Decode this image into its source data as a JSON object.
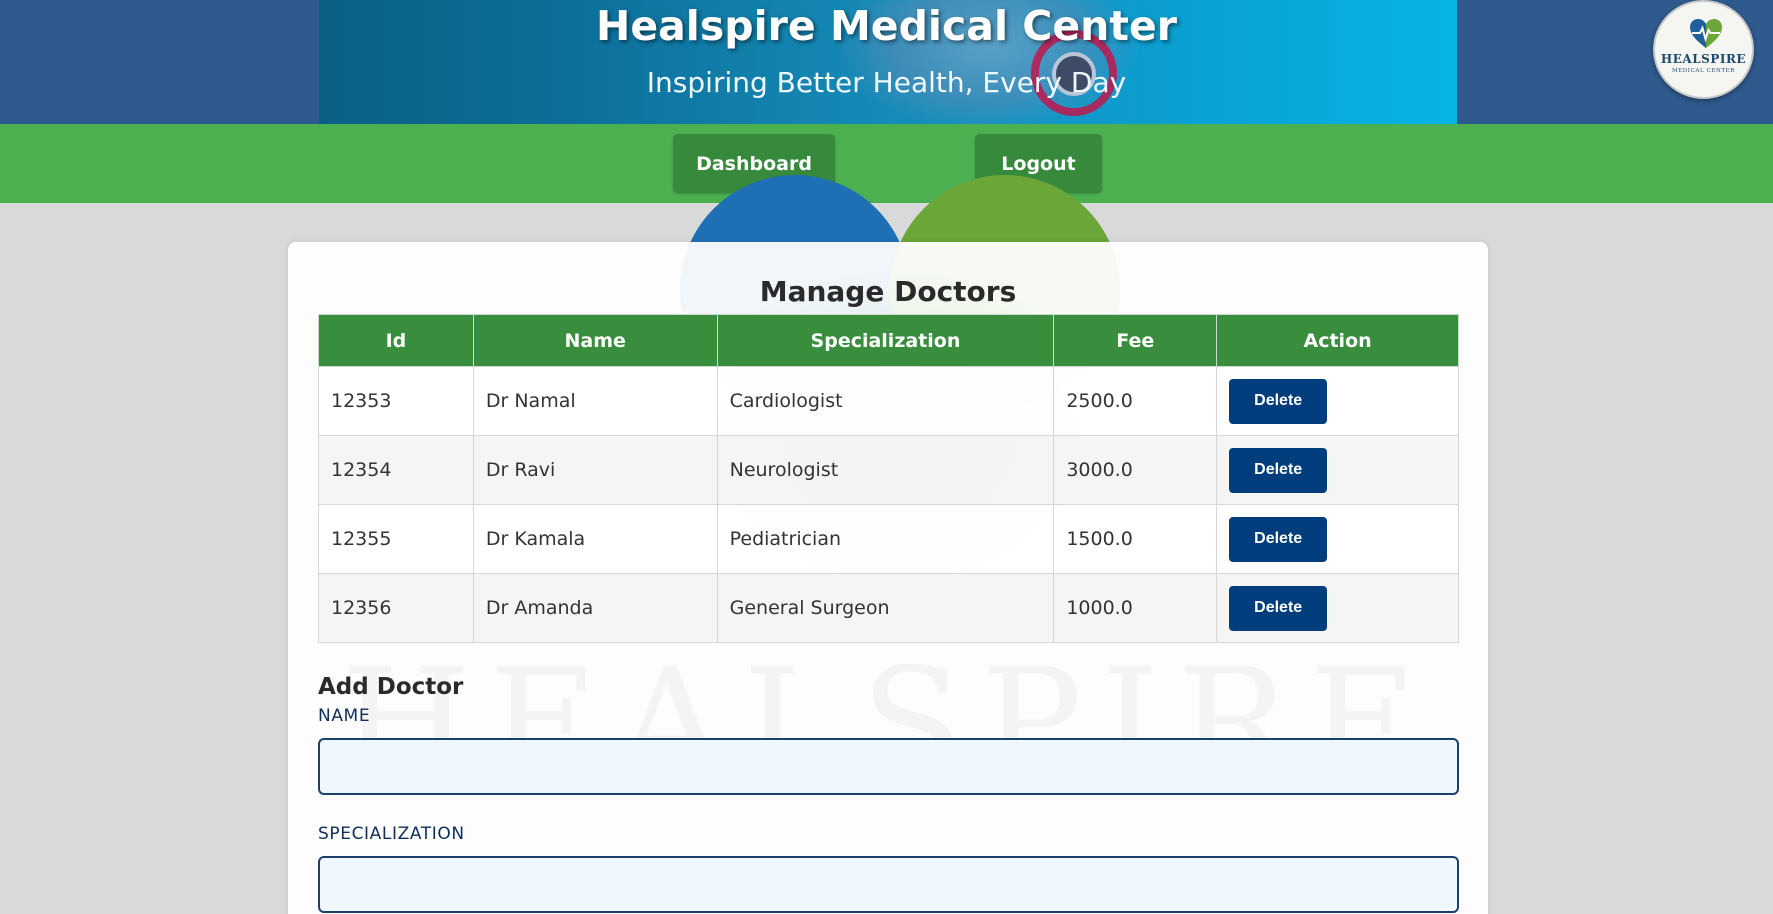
{
  "header": {
    "title": "Healspire Medical Center",
    "subtitle": "Inspiring Better Health, Every Day",
    "logo_name": "HEALSPIRE",
    "logo_sub": "MEDICAL CENTER"
  },
  "nav": {
    "dashboard": "Dashboard",
    "logout": "Logout"
  },
  "main": {
    "title": "Manage Doctors",
    "watermark": "HEALSPIRE",
    "columns": [
      "Id",
      "Name",
      "Specialization",
      "Fee",
      "Action"
    ],
    "rows": [
      {
        "id": "12353",
        "name": "Dr Namal",
        "specialization": "Cardiologist",
        "fee": "2500.0",
        "action": "Delete"
      },
      {
        "id": "12354",
        "name": "Dr Ravi",
        "specialization": "Neurologist",
        "fee": "3000.0",
        "action": "Delete"
      },
      {
        "id": "12355",
        "name": "Dr Kamala",
        "specialization": "Pediatrician",
        "fee": "1500.0",
        "action": "Delete"
      },
      {
        "id": "12356",
        "name": "Dr Amanda",
        "specialization": "General Surgeon",
        "fee": "1000.0",
        "action": "Delete"
      }
    ]
  },
  "form": {
    "title": "Add Doctor",
    "name_label": "NAME",
    "name_value": "",
    "specialization_label": "SPECIALIZATION",
    "specialization_value": ""
  },
  "colors": {
    "nav_green": "#4caf50",
    "button_green": "#378a3b",
    "header_blue": "#2f5a8d",
    "delete_blue": "#003d7c",
    "table_header": "#388e3c"
  },
  "icons": [
    "heart-pulse-icon"
  ]
}
